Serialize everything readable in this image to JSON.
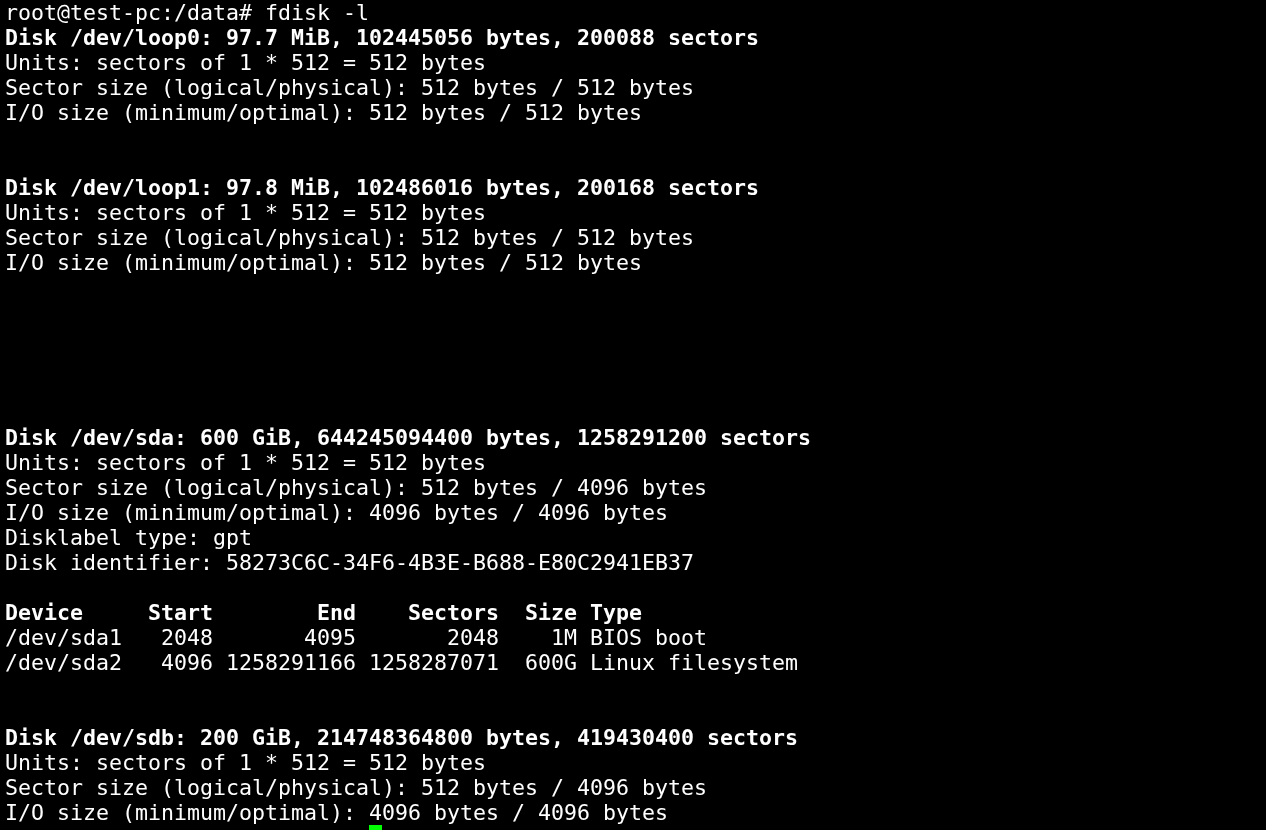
{
  "terminal": {
    "lines": [
      {
        "kind": "prompt",
        "text": "root@test-pc:/data# fdisk -l"
      },
      {
        "kind": "heading",
        "text": "Disk /dev/loop0: 97.7 MiB, 102445056 bytes, 200088 sectors"
      },
      {
        "kind": "text",
        "text": "Units: sectors of 1 * 512 = 512 bytes"
      },
      {
        "kind": "text",
        "text": "Sector size (logical/physical): 512 bytes / 512 bytes"
      },
      {
        "kind": "text",
        "text": "I/O size (minimum/optimal): 512 bytes / 512 bytes"
      },
      {
        "kind": "blank"
      },
      {
        "kind": "blank"
      },
      {
        "kind": "heading",
        "text": "Disk /dev/loop1: 97.8 MiB, 102486016 bytes, 200168 sectors"
      },
      {
        "kind": "text",
        "text": "Units: sectors of 1 * 512 = 512 bytes"
      },
      {
        "kind": "text",
        "text": "Sector size (logical/physical): 512 bytes / 512 bytes"
      },
      {
        "kind": "text",
        "text": "I/O size (minimum/optimal): 512 bytes / 512 bytes"
      },
      {
        "kind": "blank"
      },
      {
        "kind": "blank"
      },
      {
        "kind": "blank"
      },
      {
        "kind": "blank"
      },
      {
        "kind": "blank"
      },
      {
        "kind": "blank"
      },
      {
        "kind": "heading",
        "text": "Disk /dev/sda: 600 GiB, 644245094400 bytes, 1258291200 sectors"
      },
      {
        "kind": "text",
        "text": "Units: sectors of 1 * 512 = 512 bytes"
      },
      {
        "kind": "text",
        "text": "Sector size (logical/physical): 512 bytes / 4096 bytes"
      },
      {
        "kind": "text",
        "text": "I/O size (minimum/optimal): 4096 bytes / 4096 bytes"
      },
      {
        "kind": "text",
        "text": "Disklabel type: gpt"
      },
      {
        "kind": "text",
        "text": "Disk identifier: 58273C6C-34F6-4B3E-B688-E80C2941EB37"
      },
      {
        "kind": "blank"
      },
      {
        "kind": "table",
        "columns": [
          "Device",
          "Start",
          "End",
          "Sectors",
          "Size",
          "Type"
        ],
        "rows": [
          [
            "/dev/sda1",
            "2048",
            "4095",
            "2048",
            "1M",
            "BIOS boot"
          ],
          [
            "/dev/sda2",
            "4096",
            "1258291166",
            "1258287071",
            "600G",
            "Linux filesystem"
          ]
        ]
      },
      {
        "kind": "blank"
      },
      {
        "kind": "blank"
      },
      {
        "kind": "heading",
        "text": "Disk /dev/sdb: 200 GiB, 214748364800 bytes, 419430400 sectors"
      },
      {
        "kind": "text",
        "text": "Units: sectors of 1 * 512 = 512 bytes"
      },
      {
        "kind": "text",
        "text": "Sector size (logical/physical): 512 bytes / 4096 bytes"
      },
      {
        "kind": "text",
        "text": "I/O size (minimum/optimal): 4096 bytes / 4096 bytes"
      },
      {
        "kind": "cursor"
      }
    ]
  }
}
